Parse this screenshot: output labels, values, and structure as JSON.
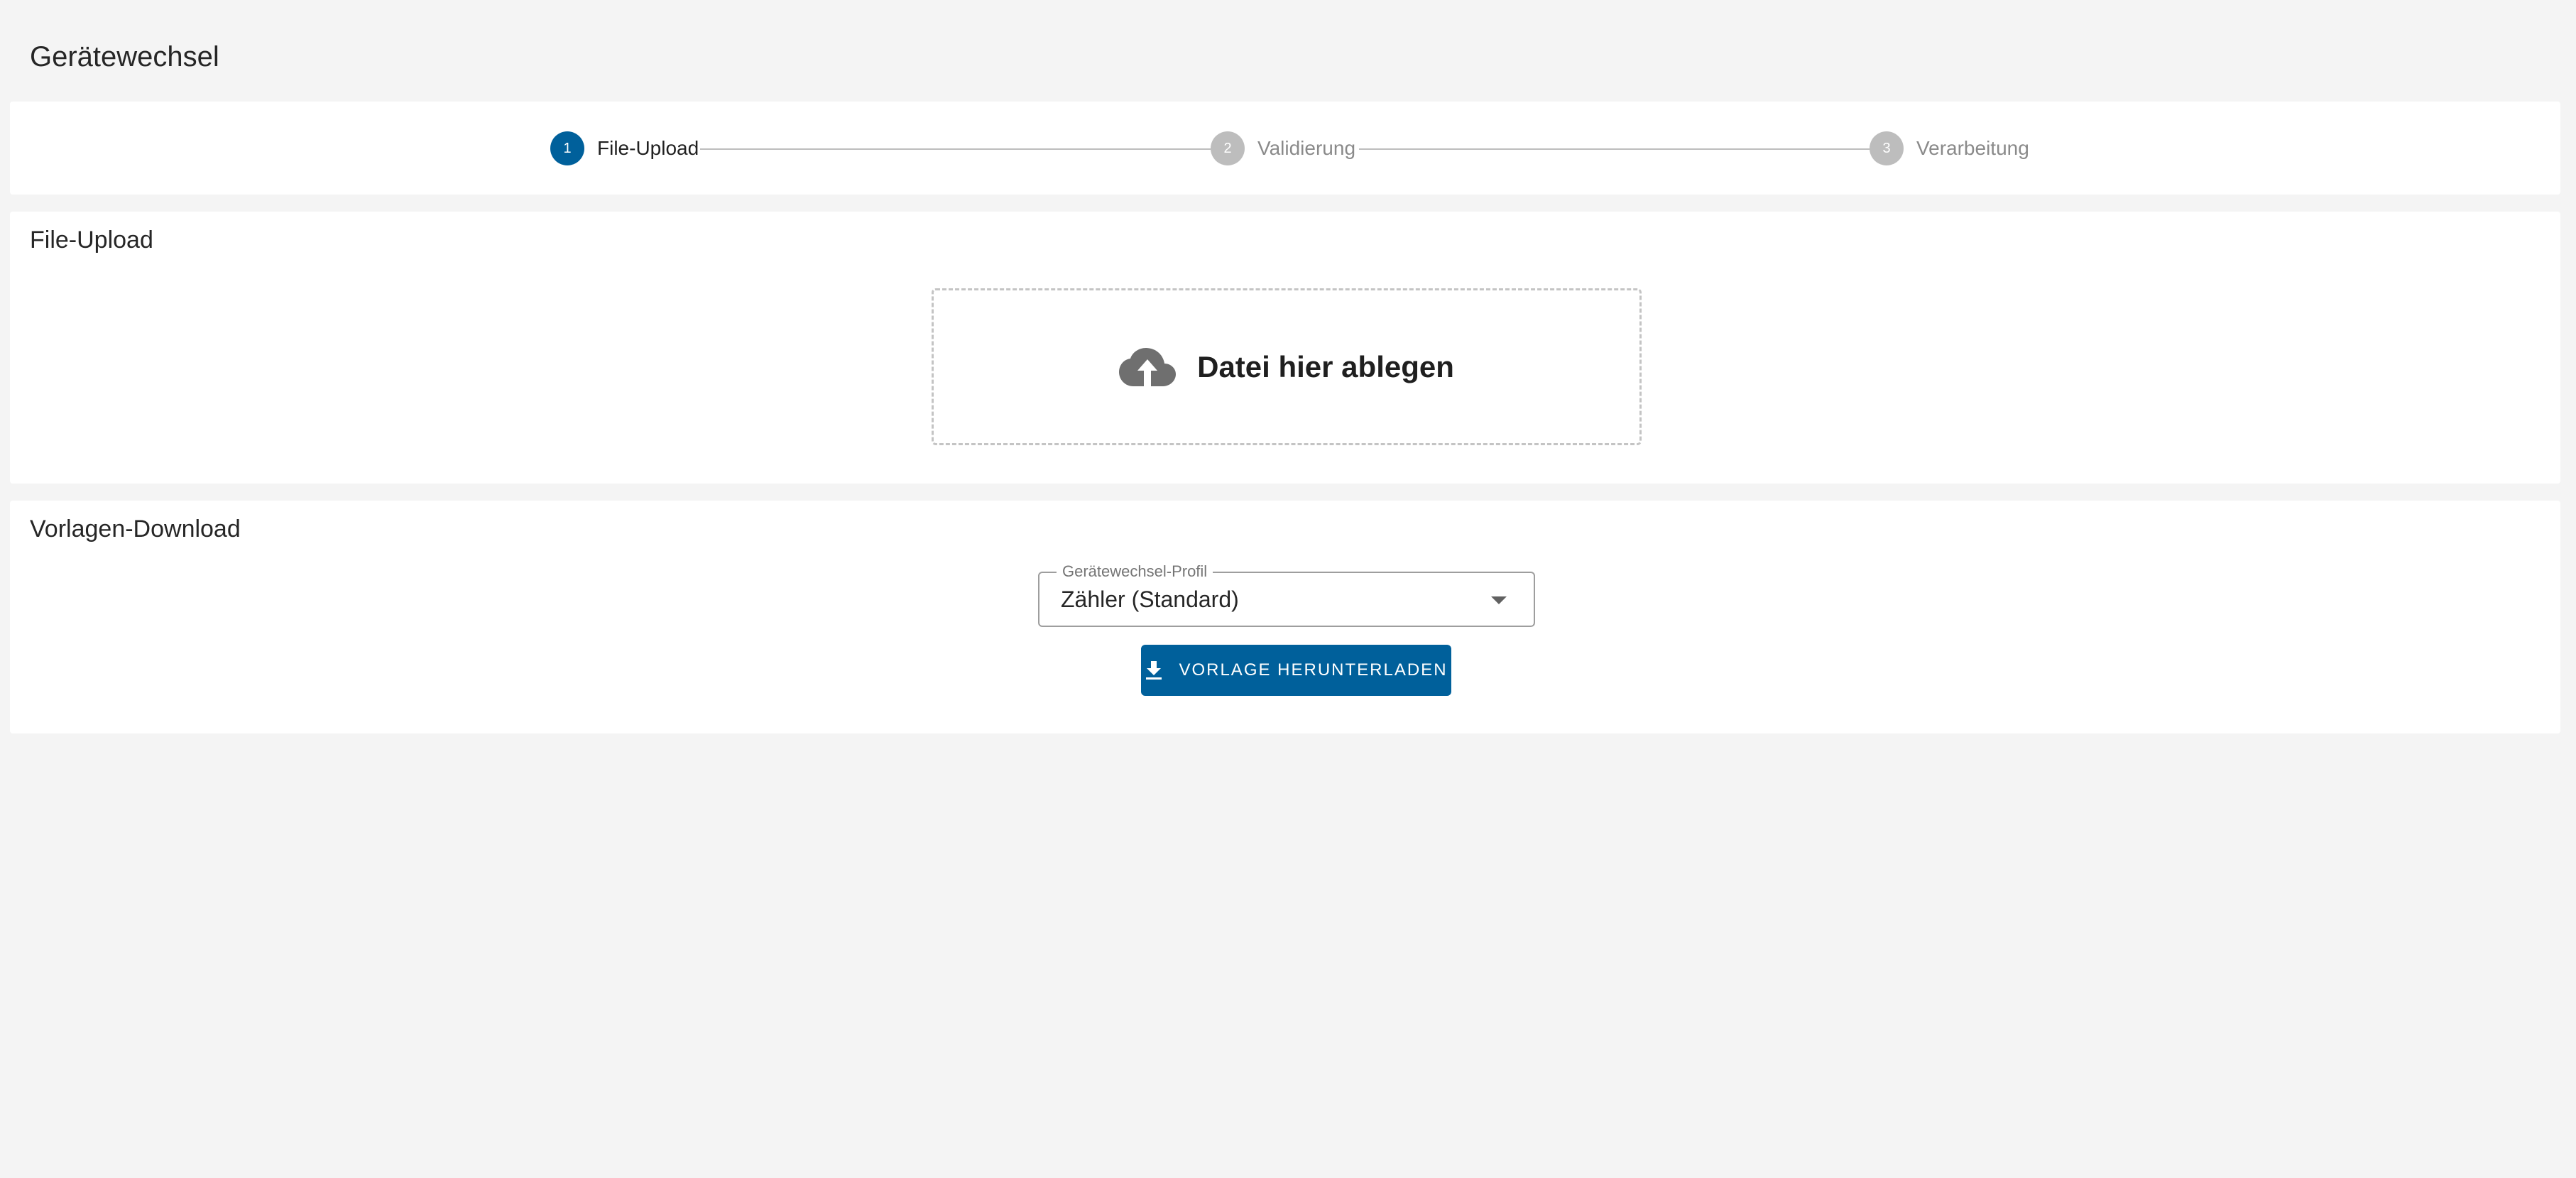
{
  "page": {
    "title": "Gerätewechsel"
  },
  "stepper": {
    "steps": [
      {
        "number": "1",
        "label": "File-Upload",
        "state": "active"
      },
      {
        "number": "2",
        "label": "Validierung",
        "state": "inactive"
      },
      {
        "number": "3",
        "label": "Verarbeitung",
        "state": "inactive"
      }
    ]
  },
  "upload": {
    "title": "File-Upload",
    "dropzone_text": "Datei hier ablegen",
    "icon": "cloud-upload-icon"
  },
  "download": {
    "title": "Vorlagen-Download",
    "profile_field": {
      "label": "Gerätewechsel-Profil",
      "value": "Zähler (Standard)"
    },
    "button_label": "VORLAGE HERUNTERLADEN",
    "button_icon": "download-icon"
  },
  "colors": {
    "primary": "#00609b",
    "inactive_step": "#bdbdbd",
    "background": "#f4f4f4",
    "panel": "#ffffff"
  }
}
